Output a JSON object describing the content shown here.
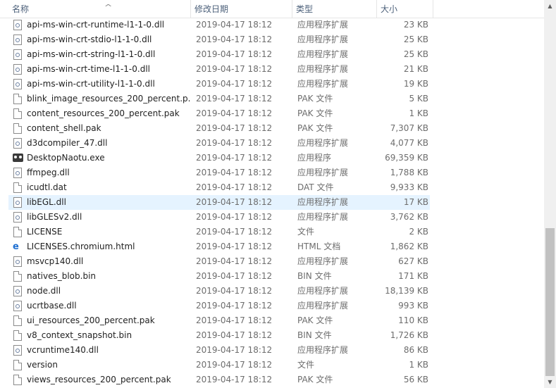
{
  "columns": {
    "name": "名称",
    "date": "修改日期",
    "type": "类型",
    "size": "大小"
  },
  "sort_indicator": "^",
  "scroll_arrows": {
    "up": "▲",
    "down": "▼"
  },
  "files": [
    {
      "name": "api-ms-win-crt-runtime-l1-1-0.dll",
      "date": "2019-04-17 18:12",
      "type": "应用程序扩展",
      "size": "23 KB",
      "icon": "dll-icon"
    },
    {
      "name": "api-ms-win-crt-stdio-l1-1-0.dll",
      "date": "2019-04-17 18:12",
      "type": "应用程序扩展",
      "size": "25 KB",
      "icon": "dll-icon"
    },
    {
      "name": "api-ms-win-crt-string-l1-1-0.dll",
      "date": "2019-04-17 18:12",
      "type": "应用程序扩展",
      "size": "25 KB",
      "icon": "dll-icon"
    },
    {
      "name": "api-ms-win-crt-time-l1-1-0.dll",
      "date": "2019-04-17 18:12",
      "type": "应用程序扩展",
      "size": "21 KB",
      "icon": "dll-icon"
    },
    {
      "name": "api-ms-win-crt-utility-l1-1-0.dll",
      "date": "2019-04-17 18:12",
      "type": "应用程序扩展",
      "size": "19 KB",
      "icon": "dll-icon"
    },
    {
      "name": "blink_image_resources_200_percent.p...",
      "date": "2019-04-17 18:12",
      "type": "PAK 文件",
      "size": "5 KB",
      "icon": "file-icon"
    },
    {
      "name": "content_resources_200_percent.pak",
      "date": "2019-04-17 18:12",
      "type": "PAK 文件",
      "size": "1 KB",
      "icon": "file-icon"
    },
    {
      "name": "content_shell.pak",
      "date": "2019-04-17 18:12",
      "type": "PAK 文件",
      "size": "7,307 KB",
      "icon": "file-icon"
    },
    {
      "name": "d3dcompiler_47.dll",
      "date": "2019-04-17 18:12",
      "type": "应用程序扩展",
      "size": "4,077 KB",
      "icon": "dll-icon"
    },
    {
      "name": "DesktopNaotu.exe",
      "date": "2019-04-17 18:12",
      "type": "应用程序",
      "size": "69,359 KB",
      "icon": "app-icon"
    },
    {
      "name": "ffmpeg.dll",
      "date": "2019-04-17 18:12",
      "type": "应用程序扩展",
      "size": "1,788 KB",
      "icon": "dll-icon"
    },
    {
      "name": "icudtl.dat",
      "date": "2019-04-17 18:12",
      "type": "DAT 文件",
      "size": "9,933 KB",
      "icon": "file-icon"
    },
    {
      "name": "libEGL.dll",
      "date": "2019-04-17 18:12",
      "type": "应用程序扩展",
      "size": "17 KB",
      "icon": "dll-icon",
      "selected": true
    },
    {
      "name": "libGLESv2.dll",
      "date": "2019-04-17 18:12",
      "type": "应用程序扩展",
      "size": "3,762 KB",
      "icon": "dll-icon"
    },
    {
      "name": "LICENSE",
      "date": "2019-04-17 18:12",
      "type": "文件",
      "size": "2 KB",
      "icon": "file-icon"
    },
    {
      "name": "LICENSES.chromium.html",
      "date": "2019-04-17 18:12",
      "type": "HTML 文档",
      "size": "1,862 KB",
      "icon": "html-icon"
    },
    {
      "name": "msvcp140.dll",
      "date": "2019-04-17 18:12",
      "type": "应用程序扩展",
      "size": "627 KB",
      "icon": "dll-icon"
    },
    {
      "name": "natives_blob.bin",
      "date": "2019-04-17 18:12",
      "type": "BIN 文件",
      "size": "171 KB",
      "icon": "file-icon"
    },
    {
      "name": "node.dll",
      "date": "2019-04-17 18:12",
      "type": "应用程序扩展",
      "size": "18,139 KB",
      "icon": "dll-icon"
    },
    {
      "name": "ucrtbase.dll",
      "date": "2019-04-17 18:12",
      "type": "应用程序扩展",
      "size": "993 KB",
      "icon": "dll-icon"
    },
    {
      "name": "ui_resources_200_percent.pak",
      "date": "2019-04-17 18:12",
      "type": "PAK 文件",
      "size": "110 KB",
      "icon": "file-icon"
    },
    {
      "name": "v8_context_snapshot.bin",
      "date": "2019-04-17 18:12",
      "type": "BIN 文件",
      "size": "1,726 KB",
      "icon": "file-icon"
    },
    {
      "name": "vcruntime140.dll",
      "date": "2019-04-17 18:12",
      "type": "应用程序扩展",
      "size": "86 KB",
      "icon": "dll-icon"
    },
    {
      "name": "version",
      "date": "2019-04-17 18:12",
      "type": "文件",
      "size": "1 KB",
      "icon": "file-icon"
    },
    {
      "name": "views_resources_200_percent.pak",
      "date": "2019-04-17 18:12",
      "type": "PAK 文件",
      "size": "56 KB",
      "icon": "file-icon"
    }
  ]
}
